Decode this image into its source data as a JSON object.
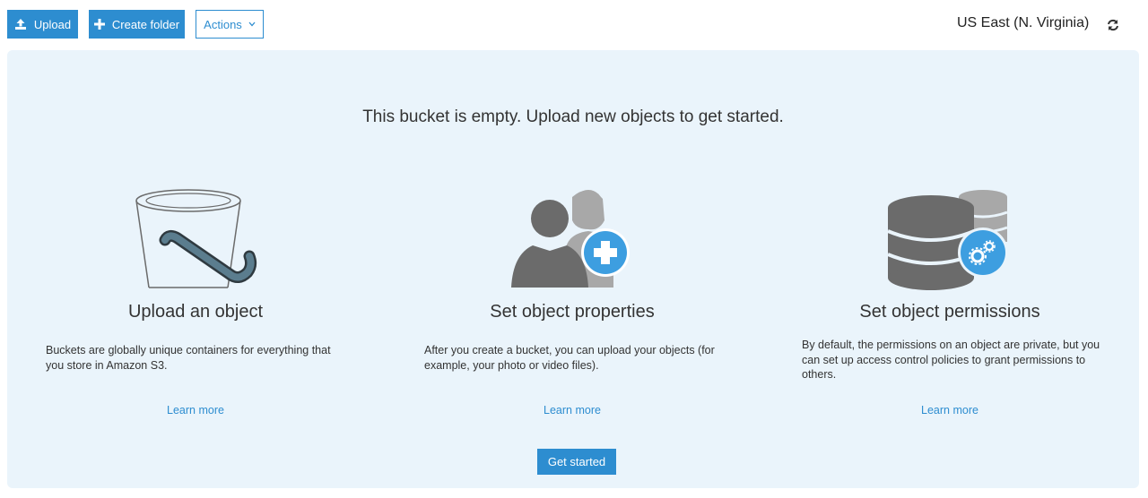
{
  "toolbar": {
    "upload_label": "Upload",
    "create_folder_label": "Create folder",
    "actions_label": "Actions",
    "region": "US East (N. Virginia)"
  },
  "main": {
    "headline": "This bucket is empty. Upload new objects to get started.",
    "cards": [
      {
        "icon": "bucket-icon",
        "title": "Upload an object",
        "description": "Buckets are globally unique containers for everything that you store in Amazon S3.",
        "link": "Learn more"
      },
      {
        "icon": "users-add-icon",
        "title": "Set object properties",
        "description": "After you create a bucket, you can upload your objects (for example, your photo or video files).",
        "link": "Learn more"
      },
      {
        "icon": "database-settings-icon",
        "title": "Set object permissions",
        "description": "By default, the permissions on an object are private, but you can set up access control policies to grant permissions to others.",
        "link": "Learn more"
      }
    ],
    "cta_label": "Get started"
  },
  "colors": {
    "accent": "#2d8dd0",
    "panel_bg": "#eaf4fb",
    "icon_gray": "#6b6b6b",
    "icon_light_gray": "#a8a8a8"
  }
}
